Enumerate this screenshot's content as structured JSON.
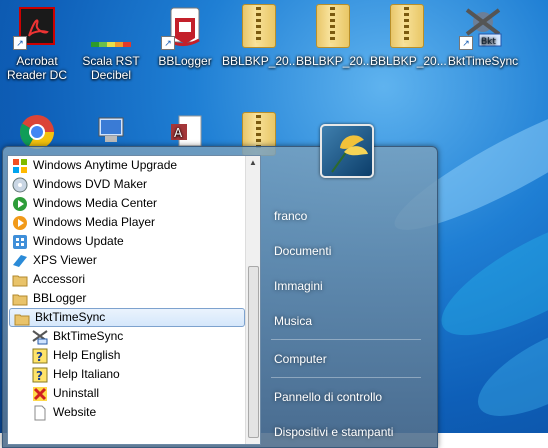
{
  "desktop": {
    "icons_row1": [
      {
        "label": "Acrobat\nReader DC",
        "icon": "acrobat-icon"
      },
      {
        "label": "Scala RST\nDecibel",
        "icon": "decibel-scale-icon"
      },
      {
        "label": "BBLogger",
        "icon": "bblogger-icon"
      },
      {
        "label": "BBLBKP_20...",
        "icon": "zip-folder-icon"
      },
      {
        "label": "BBLBKP_20...",
        "icon": "zip-folder-icon"
      },
      {
        "label": "BBLBKP_20...",
        "icon": "zip-folder-icon"
      },
      {
        "label": "BktTimeSync",
        "icon": "bkttimesync-icon"
      }
    ],
    "icons_row2": [
      {
        "icon": "chrome-icon"
      },
      {
        "icon": "computer-network-icon"
      },
      {
        "icon": "access-document-icon"
      },
      {
        "icon": "zip-folder-icon"
      }
    ]
  },
  "start_menu": {
    "programs": [
      {
        "label": "Windows Anytime Upgrade",
        "icon": "windows-anytime-upgrade-icon"
      },
      {
        "label": "Windows DVD Maker",
        "icon": "dvd-maker-icon"
      },
      {
        "label": "Windows Media Center",
        "icon": "media-center-icon"
      },
      {
        "label": "Windows Media Player",
        "icon": "media-player-icon"
      },
      {
        "label": "Windows Update",
        "icon": "windows-update-icon"
      },
      {
        "label": "XPS Viewer",
        "icon": "xps-viewer-icon"
      },
      {
        "label": "Accessori",
        "icon": "folder-icon"
      },
      {
        "label": "BBLogger",
        "icon": "folder-icon"
      },
      {
        "label": "BktTimeSync",
        "icon": "folder-icon",
        "selected": true
      },
      {
        "label": "BktTimeSync",
        "icon": "bkttimesync-icon",
        "sub": true
      },
      {
        "label": "Help English",
        "icon": "help-icon",
        "sub": true
      },
      {
        "label": "Help Italiano",
        "icon": "help-icon",
        "sub": true
      },
      {
        "label": "Uninstall",
        "icon": "uninstall-icon",
        "sub": true
      },
      {
        "label": "Website",
        "icon": "document-icon",
        "sub": true
      }
    ],
    "right": {
      "user": "franco",
      "items": [
        "Documenti",
        "Immagini",
        "Musica",
        "Computer",
        "Pannello di controllo",
        "Dispositivi e stampanti"
      ]
    }
  }
}
